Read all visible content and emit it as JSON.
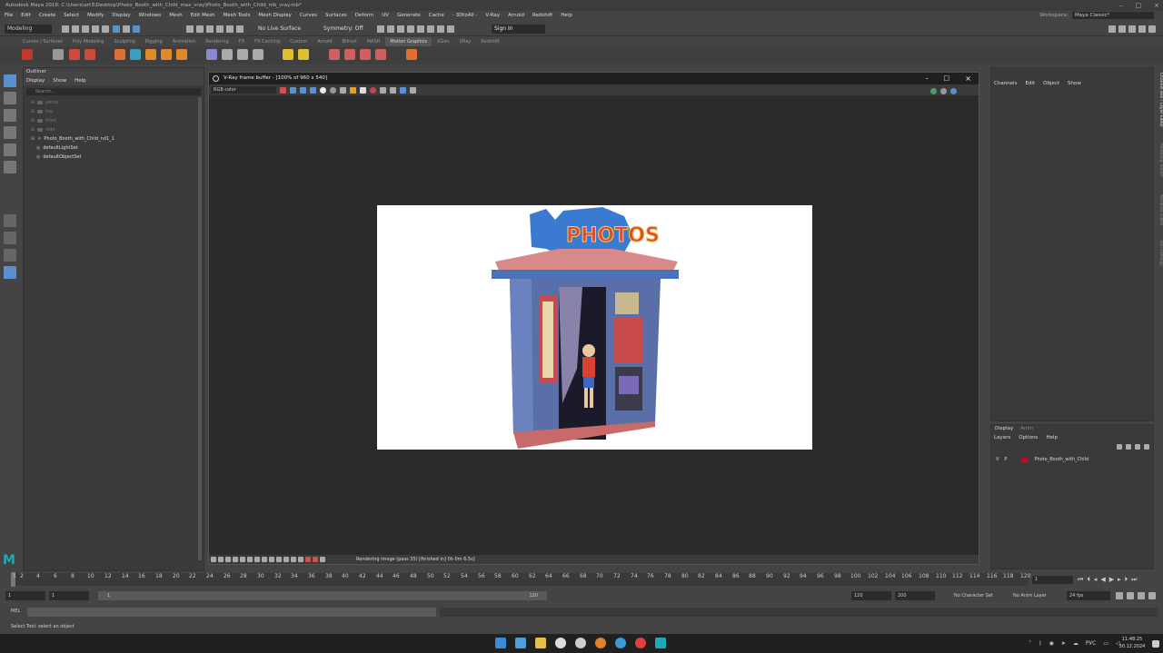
{
  "titlebar": {
    "title": "Autodesk Maya 2018: C:\\Users\\art3\\Desktop\\Photo_Booth_with_Child_max_vray\\Photo_Booth_with_Child_mb_vray.mb*"
  },
  "menu": [
    "File",
    "Edit",
    "Create",
    "Select",
    "Modify",
    "Display",
    "Windows",
    "Mesh",
    "Edit Mesh",
    "Mesh Tools",
    "Mesh Display",
    "Curves",
    "Surfaces",
    "Deform",
    "UV",
    "Generate",
    "Cache",
    "- 3DtoAll -",
    "V-Ray",
    "Arnold",
    "Redshift",
    "Help"
  ],
  "workspace": {
    "label": "Workspace:",
    "value": "Maya Classic*"
  },
  "statusline": {
    "mode": "Modeling",
    "live_surface": "No Live Surface",
    "symmetry": "Symmetry: Off",
    "sign_in": "Sign In"
  },
  "shelf_tabs": [
    "Curves / Surfaces",
    "Poly Modeling",
    "Sculpting",
    "Rigging",
    "Animation",
    "Rendering",
    "FX",
    "FX Caching",
    "Custom",
    "Arnold",
    "Bifrost",
    "MASH",
    "Motion Graphics",
    "XGen",
    "VRay",
    "Redshift"
  ],
  "shelf_active": "Motion Graphics",
  "outliner": {
    "title": "Outliner",
    "menu": [
      "Display",
      "Show",
      "Help"
    ],
    "search_placeholder": "Search...",
    "items": [
      {
        "label": "persp",
        "dim": true
      },
      {
        "label": "top",
        "dim": true
      },
      {
        "label": "front",
        "dim": true
      },
      {
        "label": "side",
        "dim": true
      },
      {
        "label": "Photo_Booth_with_Child_nd1_1",
        "dim": false
      },
      {
        "label": "defaultLightSet",
        "dim": false
      },
      {
        "label": "defaultObjectSet",
        "dim": false
      }
    ]
  },
  "vfb": {
    "title": "V-Ray frame buffer - [100% of 960 x 540]",
    "channel": "RGB color",
    "status": "Rendering image (pass 35) [finished in] 0h  0m  6.5s]",
    "render_text": "PHOTOS"
  },
  "channelbox": {
    "menu": [
      "Channels",
      "Edit",
      "Object",
      "Show"
    ]
  },
  "side_tabs": [
    "Channel Box / Layer Editor",
    "Modeling Toolkit",
    "Attribute Editor",
    "Tool Settings"
  ],
  "layers": {
    "tabs": [
      "Display",
      "Anim"
    ],
    "menu": [
      "Layers",
      "Options",
      "Help"
    ],
    "layer": {
      "v": "V",
      "p": "P",
      "name": "Photo_Booth_with_Child",
      "color": "#b0102a"
    }
  },
  "timeline": {
    "ticks": [
      "1",
      "2",
      "4",
      "6",
      "8",
      "10",
      "12",
      "14",
      "16",
      "18",
      "20",
      "22",
      "24",
      "26",
      "28",
      "30",
      "32",
      "34",
      "36",
      "38",
      "40",
      "42",
      "44",
      "46",
      "48",
      "50",
      "52",
      "54",
      "56",
      "58",
      "60",
      "62",
      "64",
      "66",
      "68",
      "70",
      "72",
      "74",
      "76",
      "78",
      "80",
      "82",
      "84",
      "86",
      "88",
      "90",
      "92",
      "94",
      "96",
      "98",
      "100",
      "102",
      "104",
      "106",
      "108",
      "110",
      "112",
      "114",
      "116",
      "118",
      "120"
    ],
    "current": "1"
  },
  "range": {
    "start": "1",
    "start2": "1",
    "slider_start": "1",
    "slider_end": "120",
    "end": "120",
    "end2": "200",
    "character": "No Character Set",
    "anim_layer": "No Anim Layer",
    "fps": "24 fps"
  },
  "cmd": {
    "label": "MEL"
  },
  "help": "Select Tool: select an object",
  "taskbar": {
    "lang": "РУС",
    "time": "11:48:25",
    "date": "30.12.2024"
  },
  "colors": {
    "accent": "#5a8fd0",
    "maya_logo": "#1fa9b5",
    "layer": "#b0102a"
  }
}
